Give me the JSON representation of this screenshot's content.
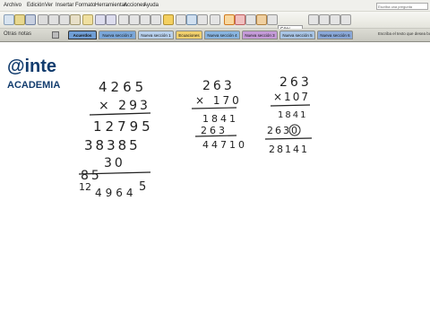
{
  "menubar": {
    "items": [
      "Archivo",
      "Edición",
      "Ver",
      "Insertar",
      "Formato",
      "Herramientas",
      "Acciones",
      "Ayuda"
    ],
    "help_placeholder": "Escriba una pregunta"
  },
  "toolbar": {
    "zoom": "50%"
  },
  "tabbar": {
    "notes_label": "Otras notas",
    "tabs": [
      {
        "label": "Acuerdos",
        "color": "#6f9dd4",
        "active": true
      },
      {
        "label": "Nueva sección 2",
        "color": "#7aa6d8",
        "active": false
      },
      {
        "label": "Nueva sección 1",
        "color": "#b8d0ec",
        "active": false
      },
      {
        "label": "Ecuaciones",
        "color": "#f0cf6c",
        "active": false
      },
      {
        "label": "Nueva sección 4",
        "color": "#88b4e0",
        "active": false
      },
      {
        "label": "Nueva sección 3",
        "color": "#c49ad8",
        "active": false
      },
      {
        "label": "Nueva sección 5",
        "color": "#a8c4e4",
        "active": false
      },
      {
        "label": "Nueva sección 6",
        "color": "#8aa8d8",
        "active": false
      }
    ],
    "hint": "Escriba el texto que desea buscar"
  },
  "logo": {
    "mark": "@inte",
    "subtitle": "ACADEMIA",
    "brand_color": "#123c6e"
  },
  "math": {
    "problem1": {
      "multiplicand": "4265",
      "multiplier": "× 293",
      "partial1": "12795",
      "partial2": "38385",
      "carry_mid": "30",
      "partial3": "85",
      "result_prefix": "12",
      "result_rest": "4964",
      "result_sup": "5"
    },
    "problem2": {
      "multiplicand": "263",
      "multiplier": "× 170",
      "partial1": "1841",
      "partial2": "263",
      "result": "44710"
    },
    "problem3": {
      "multiplicand": "263",
      "multiplier": "×107",
      "partial1": "1841",
      "partial2": "2630",
      "result": "28141"
    }
  }
}
